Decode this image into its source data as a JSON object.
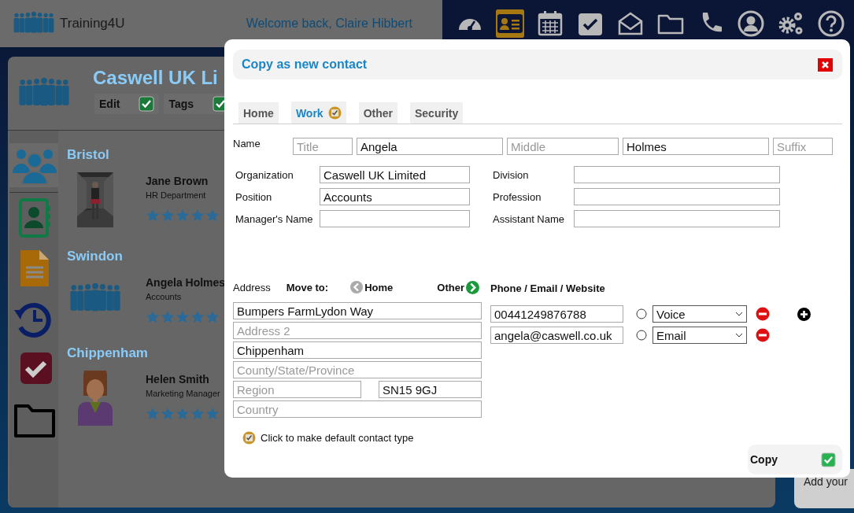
{
  "header": {
    "logo_text": "Training4U",
    "welcome": "Welcome back, Claire Hibbert",
    "nav": [
      {
        "kind": "dashboard",
        "selected": false
      },
      {
        "kind": "contacts",
        "selected": true
      },
      {
        "kind": "calendar",
        "selected": false
      },
      {
        "kind": "tasks",
        "selected": false
      },
      {
        "kind": "mail",
        "selected": false
      },
      {
        "kind": "folder",
        "selected": false
      },
      {
        "kind": "phone",
        "selected": false
      },
      {
        "kind": "profile",
        "selected": false
      },
      {
        "kind": "settings",
        "selected": false
      },
      {
        "kind": "help",
        "selected": false
      }
    ]
  },
  "company": {
    "title": "Caswell UK Li",
    "toggles": [
      {
        "label": "Edit",
        "checked": true
      },
      {
        "label": "Tags",
        "checked": true
      }
    ],
    "side_icons": [
      {
        "kind": "people",
        "selected": true
      },
      {
        "kind": "contacts",
        "selected": false
      },
      {
        "kind": "document",
        "selected": false
      },
      {
        "kind": "history",
        "selected": false
      },
      {
        "kind": "tasks",
        "selected": false
      },
      {
        "kind": "folder",
        "selected": false
      }
    ],
    "groups": [
      {
        "name": "Bristol",
        "contacts": [
          {
            "name": "Jane Brown",
            "department": "HR Department",
            "stars": 5,
            "kind": "picture"
          }
        ]
      },
      {
        "name": "Swindon",
        "contacts": [
          {
            "name": "Angela Holmes",
            "department": "Accounts",
            "stars": 5,
            "kind": "group"
          }
        ]
      },
      {
        "name": "Chippenham",
        "contacts": [
          {
            "name": "Helen Smith",
            "department": "Marketing Manager",
            "stars": 5,
            "kind": "figure"
          }
        ]
      }
    ]
  },
  "notes": {
    "prompt": "Add your"
  },
  "dialog": {
    "title": "Copy as new contact",
    "tabs": [
      {
        "label": "Home",
        "selected": false,
        "default": false
      },
      {
        "label": "Work",
        "selected": true,
        "default": true
      },
      {
        "label": "Other",
        "selected": false,
        "default": false
      },
      {
        "label": "Security",
        "selected": false,
        "default": false
      }
    ],
    "name_label": "Name",
    "name_fields": [
      {
        "placeholder": "Title"
      },
      {
        "value": "Angela"
      },
      {
        "placeholder": "Middle"
      },
      {
        "value": "Holmes"
      },
      {
        "placeholder": "Suffix"
      }
    ],
    "work_fields": [
      {
        "label": "Organization",
        "value": "Caswell UK Limited"
      },
      {
        "label": "Division"
      },
      {
        "label": "Position",
        "value": "Accounts"
      },
      {
        "label": "Profession"
      },
      {
        "label": "Manager's Name"
      },
      {
        "label": "Assistant Name"
      }
    ],
    "address": {
      "label": "Address",
      "move_label": "Move to:",
      "move_prev": "Home",
      "move_next": "Other",
      "lines": [
        {
          "kind": "full",
          "value": "Bumpers FarmLydon Way"
        },
        {
          "kind": "full",
          "placeholder": "Address 2"
        },
        {
          "kind": "full",
          "value": "Chippenham"
        },
        {
          "kind": "full",
          "placeholder": "County/State/Province"
        },
        {
          "kind": "half",
          "placeholder": "Region"
        },
        {
          "kind": "half",
          "value": "SN15 9GJ"
        },
        {
          "kind": "full",
          "placeholder": "Country"
        }
      ]
    },
    "channels": {
      "heading": "Phone / Email / Website",
      "entries": [
        {
          "value": "00441249876788",
          "selected": false,
          "type": "Voice",
          "can_add": true
        },
        {
          "value": "angela@caswell.co.uk",
          "selected": false,
          "type": "Email",
          "can_add": false
        }
      ]
    },
    "default_toggle": {
      "label": "Click to make default contact type",
      "checked": true
    },
    "copy_button": "Copy"
  }
}
